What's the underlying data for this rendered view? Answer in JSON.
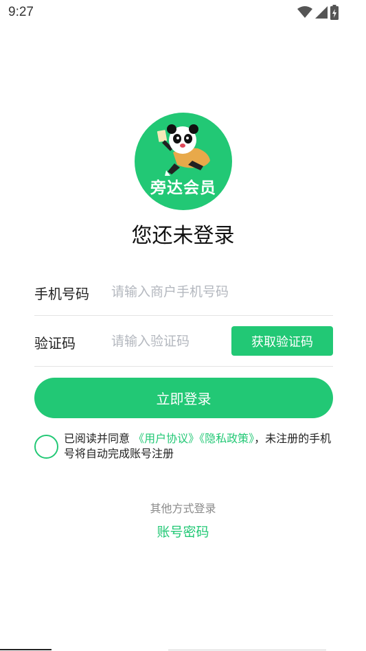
{
  "status_bar": {
    "time": "9:27",
    "icons": [
      "wifi-icon",
      "signal-icon",
      "battery-icon"
    ]
  },
  "logo": {
    "text": "旁达会员"
  },
  "title": "您还未登录",
  "form": {
    "phone_label": "手机号码",
    "phone_placeholder": "请输入商户手机号码",
    "code_label": "验证码",
    "code_placeholder": "请输入验证码",
    "get_code_button": "获取验证码"
  },
  "login_button": "立即登录",
  "agreement": {
    "prefix": "已阅读并同意 ",
    "user_agreement": "《用户协议》",
    "privacy_policy": "《隐私政策》",
    "suffix": "，未注册的手机号将自动完成账号注册",
    "checked": false
  },
  "other_login": {
    "label": "其他方式登录",
    "account_password": "账号密码"
  },
  "colors": {
    "accent": "#22c875",
    "placeholder": "#b4b8bf",
    "divider": "#e3e3e3"
  }
}
